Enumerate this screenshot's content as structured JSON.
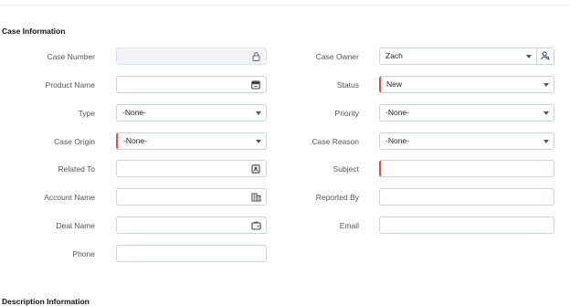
{
  "sections": {
    "case_information": "Case Information",
    "description_information": "Description Information"
  },
  "left": {
    "case_number": {
      "label": "Case Number",
      "value": ""
    },
    "product_name": {
      "label": "Product Name",
      "value": ""
    },
    "type": {
      "label": "Type",
      "value": "-None-"
    },
    "case_origin": {
      "label": "Case Origin",
      "value": "-None-"
    },
    "related_to": {
      "label": "Related To",
      "value": ""
    },
    "account_name": {
      "label": "Account Name",
      "value": ""
    },
    "deal_name": {
      "label": "Deal Name",
      "value": ""
    },
    "phone": {
      "label": "Phone",
      "value": ""
    }
  },
  "right": {
    "case_owner": {
      "label": "Case Owner",
      "value": "Zach"
    },
    "status": {
      "label": "Status",
      "value": "New"
    },
    "priority": {
      "label": "Priority",
      "value": "-None-"
    },
    "case_reason": {
      "label": "Case Reason",
      "value": "-None-"
    },
    "subject": {
      "label": "Subject",
      "value": ""
    },
    "reported_by": {
      "label": "Reported By",
      "value": ""
    },
    "email": {
      "label": "Email",
      "value": ""
    }
  },
  "colors": {
    "required_marker": "#e5484d",
    "field_border": "#cfd3da"
  },
  "icons": {
    "case_number": "lock-icon",
    "product_name": "product-lookup-icon",
    "related_to": "contact-lookup-icon",
    "account_name": "building-icon",
    "deal_name": "deal-wallet-icon",
    "case_owner": "user-lookup-icon"
  }
}
